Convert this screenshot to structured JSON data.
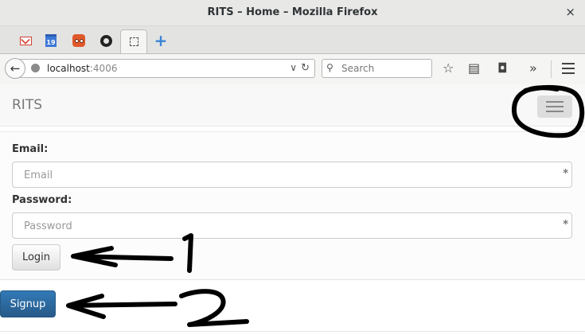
{
  "window": {
    "title": "RITS – Home – Mozilla Firefox",
    "close_glyph": "×"
  },
  "tabs": [
    {
      "icon": "gmail-icon"
    },
    {
      "icon": "calendar-icon",
      "label": "19"
    },
    {
      "icon": "owl-icon"
    },
    {
      "icon": "github-icon"
    },
    {
      "icon": "blank-page-icon",
      "active": true
    }
  ],
  "newtab": {
    "glyph": "+"
  },
  "nav": {
    "back_glyph": "←",
    "url_host": "localhost",
    "url_port": ":4006",
    "dropdown_glyph": "∨",
    "reload_glyph": "↻",
    "search_placeholder": "Search",
    "search_glyph": "⚲",
    "bookmark_glyph": "☆",
    "reader_glyph": "▤",
    "pocket_glyph": "◘",
    "overflow_glyph": "»"
  },
  "app": {
    "brand": "RITS",
    "email_label": "Email:",
    "email_placeholder": "Email",
    "password_label": "Password:",
    "password_placeholder": "Password",
    "field_icon_glyph": "*",
    "login_label": "Login",
    "signup_label": "Signup"
  },
  "annotations": {
    "label_1": "1",
    "label_2": "2"
  },
  "colors": {
    "signup_bg": "#337ab7",
    "brand_text": "#777777",
    "annotation_ink": "#000000"
  }
}
